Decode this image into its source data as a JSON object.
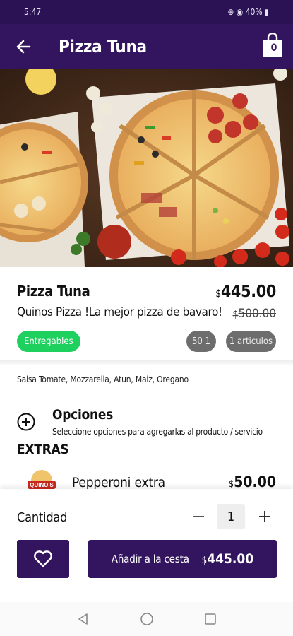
{
  "status_bar": {
    "time": "5:47",
    "right": "⊕ ◉ 40% ▮"
  },
  "header": {
    "title": "Pizza Tuna",
    "cart_count": "0"
  },
  "product": {
    "name": "Pizza Tuna",
    "description": "Quinos Pizza !La mejor pizza de bavaro!",
    "currency": "$",
    "price": "445.00",
    "old_price": "500.00",
    "tag": "Entregables",
    "points": "50 1",
    "items": "1 articulos",
    "ingredients": "Salsa Tomate, Mozzarella, Atun, Maiz, Oregano"
  },
  "options": {
    "title": "Opciones",
    "subtitle": "Seleccione opciones para agregarlas al producto / servicio"
  },
  "extras": {
    "title": "EXTRAS",
    "items": [
      {
        "logo_text": "QUINO'S",
        "name": "Pepperoni extra",
        "currency": "$",
        "price": "50.00"
      }
    ]
  },
  "cart": {
    "quantity_label": "Cantidad",
    "quantity": "1",
    "add_label": "Añadir a la cesta",
    "currency": "$",
    "total": "445.00"
  },
  "colors": {
    "primary": "#33145e",
    "status_bar": "#2a1254",
    "green": "#1ed05e",
    "gray_pill": "#6d6d6d"
  }
}
